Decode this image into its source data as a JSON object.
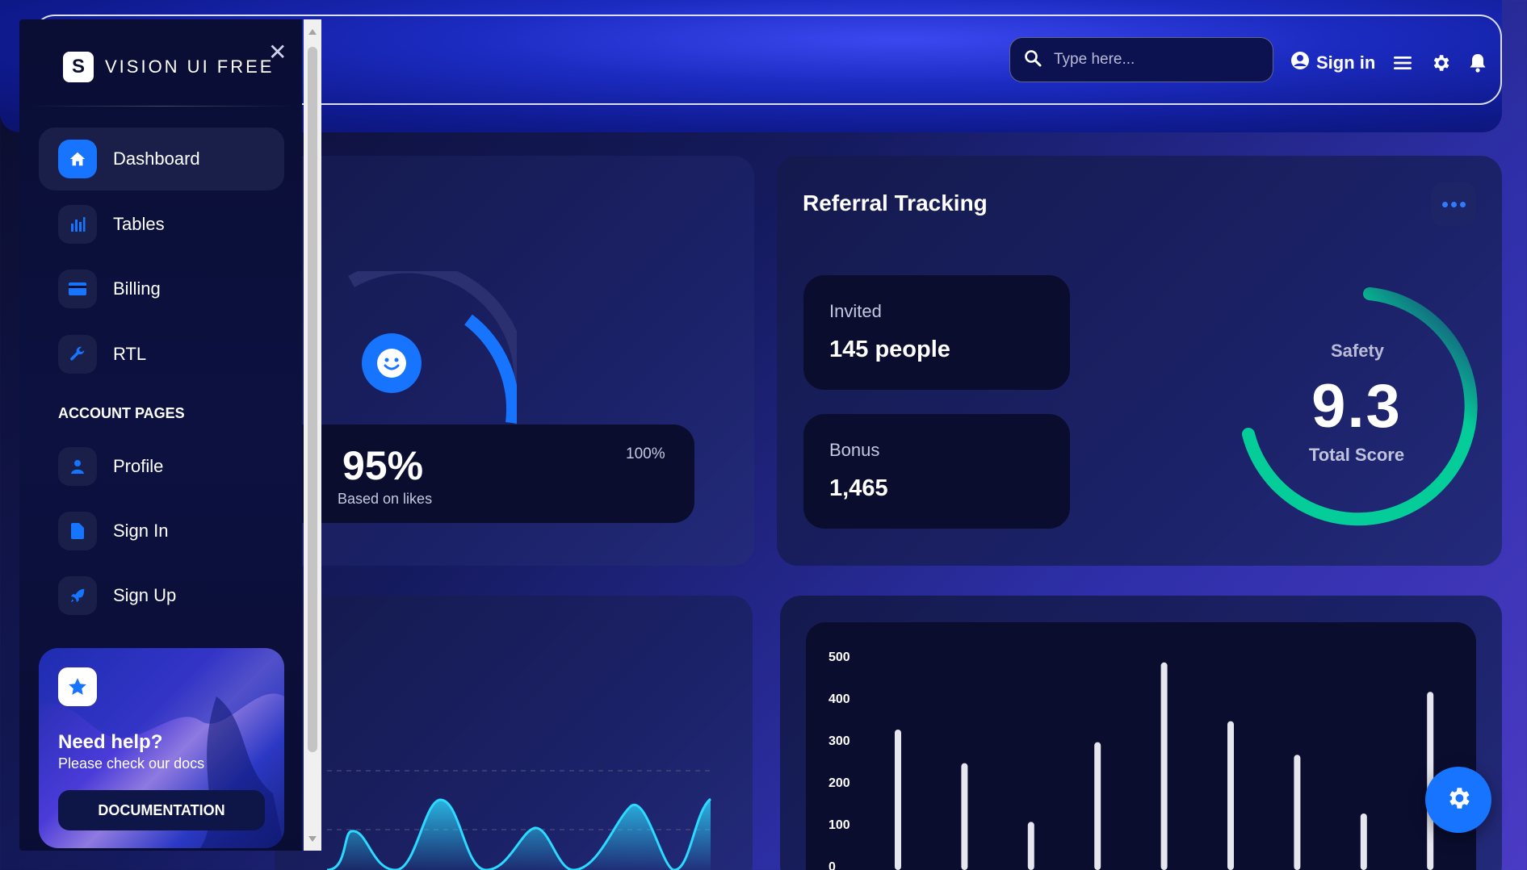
{
  "header": {
    "search_placeholder": "Type here...",
    "signin_label": "Sign in"
  },
  "sidebar": {
    "brand": "VISION UI FREE",
    "items": [
      {
        "label": "Dashboard",
        "icon": "home-icon"
      },
      {
        "label": "Tables",
        "icon": "bar-chart-icon"
      },
      {
        "label": "Billing",
        "icon": "credit-card-icon"
      },
      {
        "label": "RTL",
        "icon": "wrench-icon"
      }
    ],
    "section_label": "ACCOUNT PAGES",
    "account_items": [
      {
        "label": "Profile",
        "icon": "person-icon"
      },
      {
        "label": "Sign In",
        "icon": "document-icon"
      },
      {
        "label": "Sign Up",
        "icon": "rocket-icon"
      }
    ],
    "help": {
      "title": "Need help?",
      "subtitle": "Please check our docs",
      "button": "DOCUMENTATION"
    }
  },
  "satisfaction": {
    "percent": "95%",
    "based": "Based on likes",
    "max": "100%"
  },
  "referral": {
    "title": "Referral Tracking",
    "invited_label": "Invited",
    "invited_value": "145 people",
    "bonus_label": "Bonus",
    "bonus_value": "1,465",
    "safety_label": "Safety",
    "score": "9.3",
    "score_label": "Total Score",
    "score_max": 10
  },
  "colors": {
    "accent": "#1774ff",
    "gauge_green": "#05cd99",
    "line_cyan": "#2cd9ff"
  },
  "chart_data": {
    "type": "bar",
    "yticks": [
      "500",
      "400",
      "300",
      "200",
      "100",
      "0"
    ],
    "ylim": [
      0,
      500
    ],
    "values": [
      325,
      245,
      105,
      295,
      485,
      345,
      265,
      125,
      415
    ],
    "grid": false
  }
}
